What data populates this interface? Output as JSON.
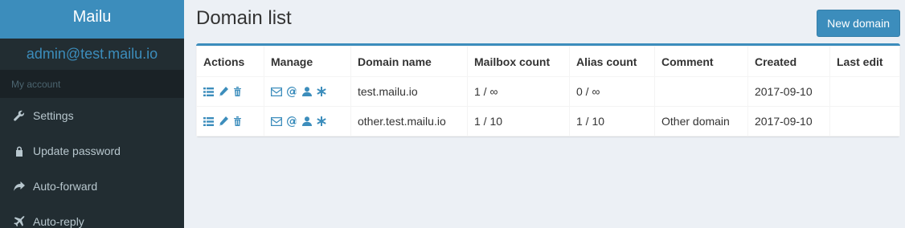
{
  "brand": "Mailu",
  "user_email": "admin@test.mailu.io",
  "sidebar": {
    "header": "My account",
    "items": [
      {
        "label": "Settings",
        "icon": "wrench-icon"
      },
      {
        "label": "Update password",
        "icon": "lock-icon"
      },
      {
        "label": "Auto-forward",
        "icon": "share-icon"
      },
      {
        "label": "Auto-reply",
        "icon": "plane-icon"
      }
    ]
  },
  "page": {
    "title": "Domain list",
    "new_button": "New domain"
  },
  "table": {
    "headers": [
      "Actions",
      "Manage",
      "Domain name",
      "Mailbox count",
      "Alias count",
      "Comment",
      "Created",
      "Last edit"
    ],
    "rows": [
      {
        "domain": "test.mailu.io",
        "mailbox": "1 / ∞",
        "alias": "0 / ∞",
        "comment": "",
        "created": "2017-09-10",
        "last_edit": ""
      },
      {
        "domain": "other.test.mailu.io",
        "mailbox": "1 / 10",
        "alias": "1 / 10",
        "comment": "Other domain",
        "created": "2017-09-10",
        "last_edit": ""
      }
    ]
  },
  "colors": {
    "accent": "#3c8dbc",
    "sidebar_bg": "#222d32",
    "page_bg": "#ecf0f5"
  }
}
